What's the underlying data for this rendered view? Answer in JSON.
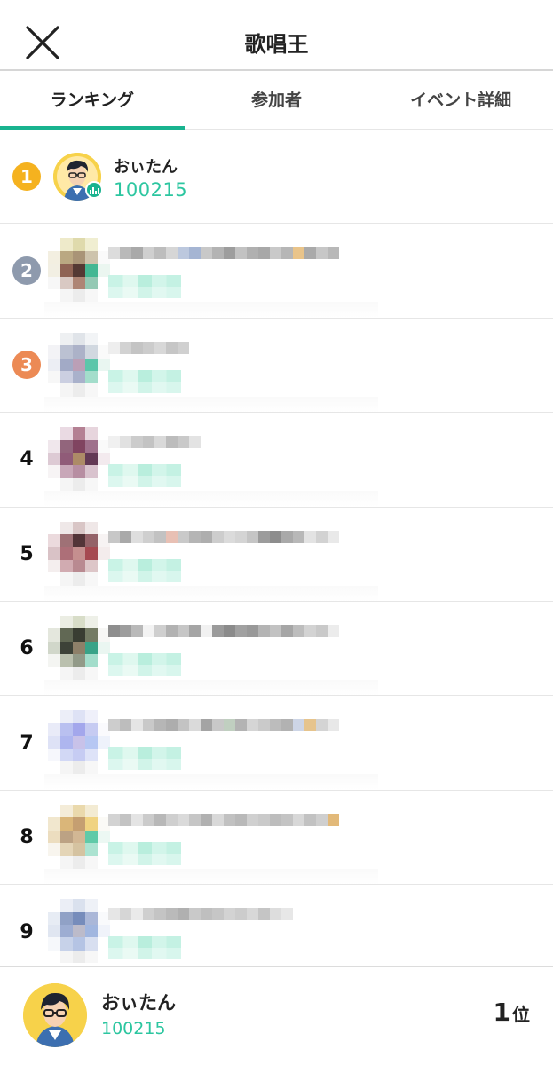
{
  "header": {
    "title": "歌唱王"
  },
  "tabs": [
    {
      "label": "ランキング",
      "active": true
    },
    {
      "label": "参加者",
      "active": false
    },
    {
      "label": "イベント詳細",
      "active": false
    }
  ],
  "ranking": {
    "first": {
      "rank": "1",
      "name": "おぃたん",
      "score": "100215",
      "medal_color": "#f5b21f"
    },
    "others": [
      {
        "rank": "2",
        "medal_color": "#8e9aad"
      },
      {
        "rank": "3",
        "medal_color": "#ec8a55"
      },
      {
        "rank": "4"
      },
      {
        "rank": "5"
      },
      {
        "rank": "6"
      },
      {
        "rank": "7"
      },
      {
        "rank": "8"
      },
      {
        "rank": "9"
      }
    ]
  },
  "footer": {
    "name": "おぃたん",
    "score": "100215",
    "rank_num": "1",
    "rank_unit": "位"
  },
  "colors": {
    "accent": "#19b38f",
    "score": "#2cc6a0",
    "gold": "#f5b21f",
    "silver": "#8e9aad",
    "bronze": "#ec8a55"
  }
}
